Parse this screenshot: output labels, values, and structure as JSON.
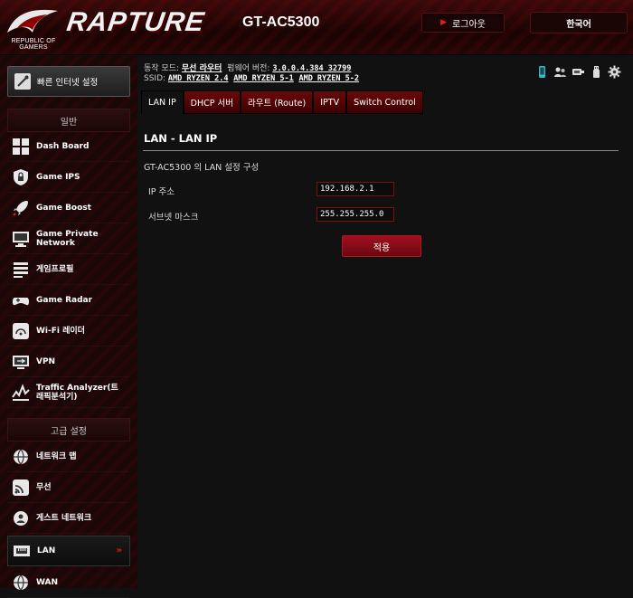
{
  "header": {
    "brand": "RAPTURE",
    "rog_line1": "REPUBLIC OF",
    "rog_line2": "GAMERS",
    "model": "GT-AC5300",
    "logout_label": "로그아웃",
    "language": "한국어"
  },
  "sidebar": {
    "quick_setup": "빠른 인터넷 설정",
    "section_general": "일반",
    "general_items": [
      {
        "label": "Dash Board",
        "icon": "dashboard-icon"
      },
      {
        "label": "Game IPS",
        "icon": "shield-lock-icon"
      },
      {
        "label": "Game Boost",
        "icon": "rocket-icon"
      },
      {
        "label": "Game Private Network",
        "icon": "monitor-network-icon"
      },
      {
        "label": "게임프로필",
        "icon": "profile-list-icon"
      },
      {
        "label": "Game Radar",
        "icon": "gamepad-icon"
      },
      {
        "label": "Wi-Fi 레이더",
        "icon": "wifi-radar-icon"
      },
      {
        "label": "VPN",
        "icon": "vpn-icon"
      },
      {
        "label": "Traffic Analyzer(트래픽분석기)",
        "icon": "traffic-chart-icon"
      }
    ],
    "section_advanced": "고급 설정",
    "advanced_items": [
      {
        "label": "네트워크 맵",
        "icon": "globe-icon"
      },
      {
        "label": "무선",
        "icon": "wireless-icon"
      },
      {
        "label": "게스트 네트워크",
        "icon": "guest-network-icon"
      },
      {
        "label": "LAN",
        "icon": "lan-icon"
      },
      {
        "label": "WAN",
        "icon": "wan-globe-icon"
      }
    ],
    "active_chevron": "»"
  },
  "status": {
    "mode_label": "동작 모드:",
    "mode_value": "무선 라우터",
    "fw_label": "펌웨어 버전:",
    "fw_value": "3.0.0.4.384_32799",
    "ssid_label": "SSID:",
    "ssid_values": [
      "AMD_RYZEN_2.4",
      "AMD_RYZEN_5-1",
      "AMD_RYZEN_5-2"
    ]
  },
  "tabs": [
    {
      "label": "LAN IP",
      "active": true
    },
    {
      "label": "DHCP 서버",
      "active": false
    },
    {
      "label": "라우트 (Route)",
      "active": false
    },
    {
      "label": "IPTV",
      "active": false
    },
    {
      "label": "Switch Control",
      "active": false
    }
  ],
  "content": {
    "title": "LAN - LAN IP",
    "description": "GT-AC5300 의 LAN 설정 구성",
    "ip_label": "IP 주소",
    "ip_value": "192.168.2.1",
    "mask_label": "서브넷 마스크",
    "mask_value": "255.255.255.0",
    "apply_label": "적용"
  },
  "colors": {
    "accent": "#a0101e",
    "tab": "#6a0808",
    "background": "#111111"
  }
}
